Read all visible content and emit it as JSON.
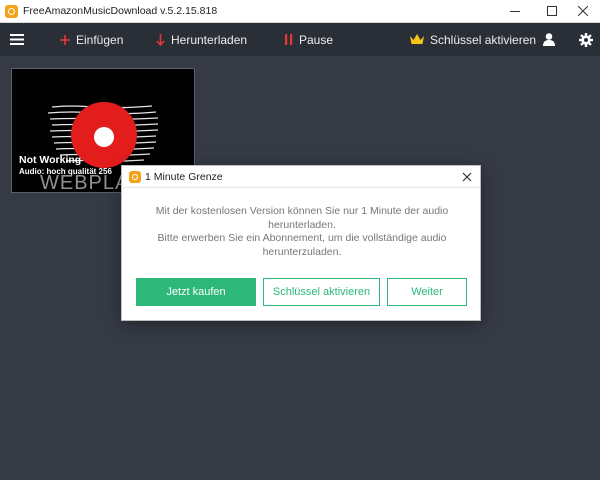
{
  "window": {
    "title": "FreeAmazonMusicDownload  v.5.2.15.818"
  },
  "toolbar": {
    "add_label": "Einfügen",
    "download_label": "Herunterladen",
    "pause_label": "Pause",
    "activate_label": "Schlüssel aktivieren",
    "accent_color": "#e53935",
    "crown_color": "#f5c518"
  },
  "card": {
    "title": "Not Working",
    "subtitle": "Audio: hoch qualität  256",
    "watermark": "WEBPLA"
  },
  "dialog": {
    "title": "1 Minute Grenze",
    "message_line1": "Mit der kostenlosen Version können Sie nur 1 Minute der audio",
    "message_line2": "herunterladen.",
    "message_line3": "Bitte erwerben Sie ein Abonnement, um die vollständige audio",
    "message_line4": "herunterzuladen.",
    "buy_label": "Jetzt kaufen",
    "activate_label": "Schlüssel aktivieren",
    "continue_label": "Weiter",
    "accent_color": "#2db87a"
  }
}
